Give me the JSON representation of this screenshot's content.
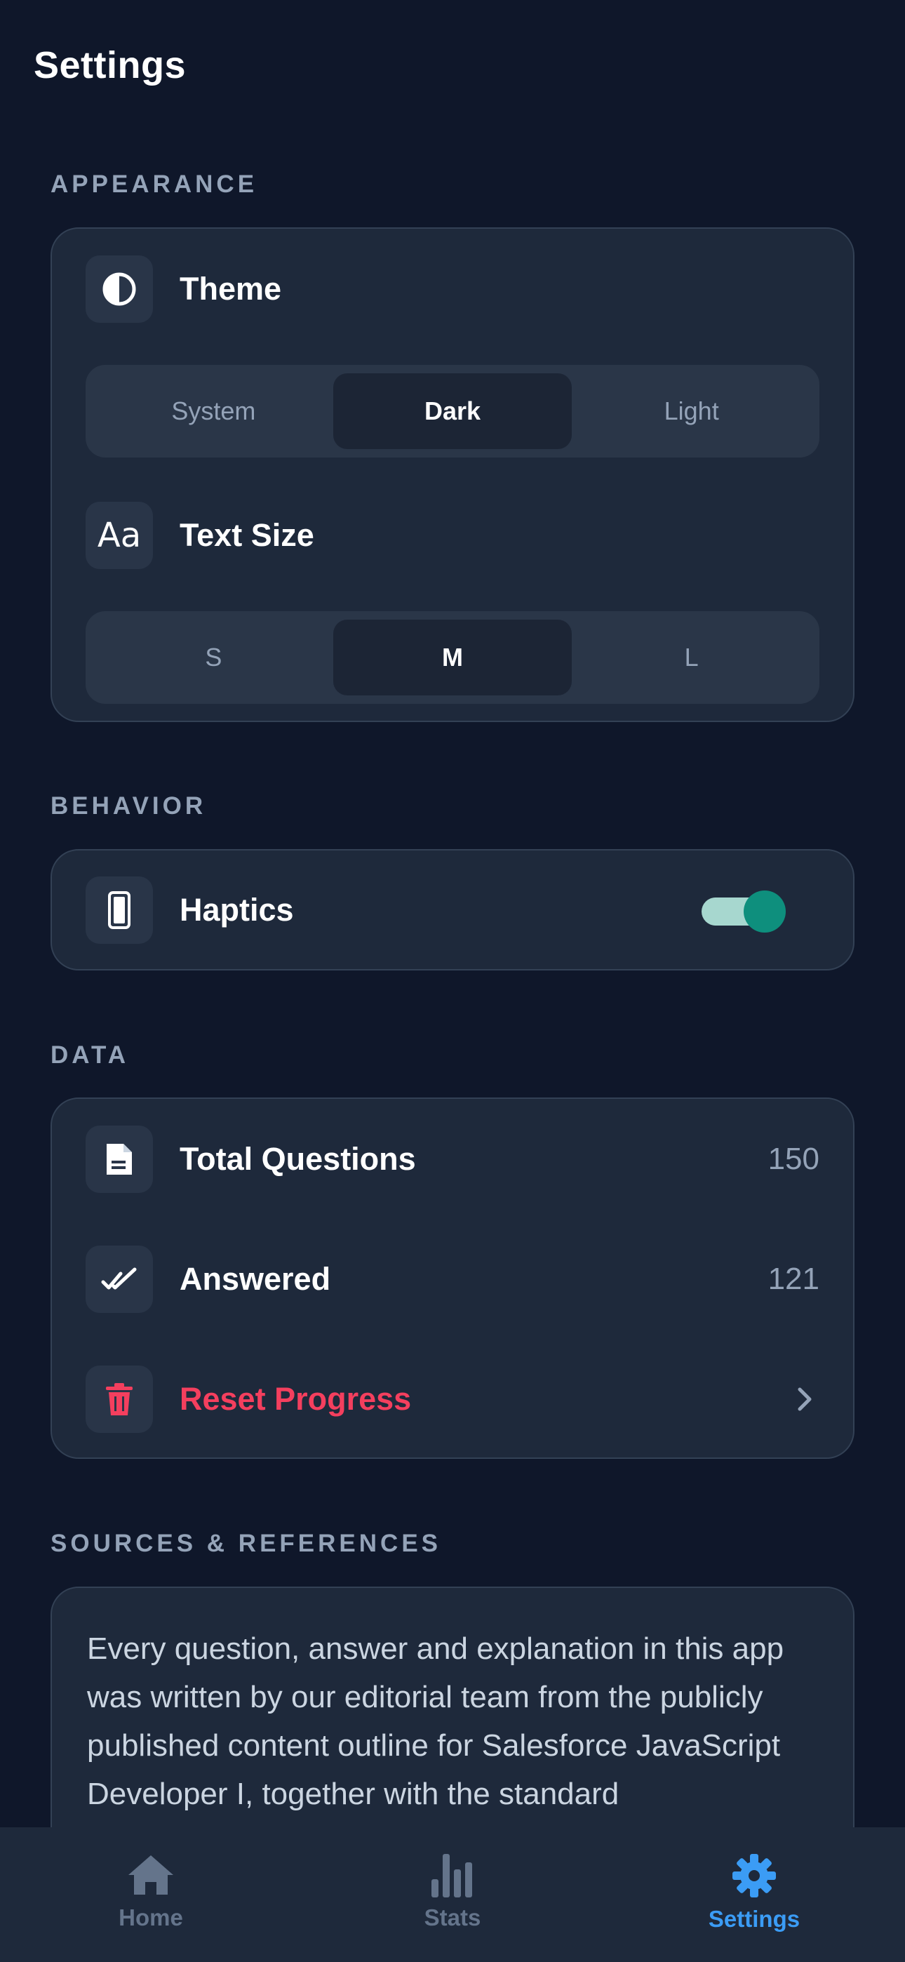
{
  "page": {
    "title": "Settings"
  },
  "sections": {
    "appearance": "APPEARANCE",
    "behavior": "BEHAVIOR",
    "data": "DATA",
    "sources": "SOURCES & REFERENCES"
  },
  "theme": {
    "label": "Theme",
    "icon": "half-circle-icon",
    "options": [
      "System",
      "Dark",
      "Light"
    ],
    "selected": "Dark"
  },
  "text_size": {
    "label": "Text Size",
    "icon": "text-aa-icon",
    "options": [
      "S",
      "M",
      "L"
    ],
    "selected": "M"
  },
  "haptics": {
    "label": "Haptics",
    "icon": "phone-icon",
    "enabled": true
  },
  "data_rows": {
    "total_label": "Total Questions",
    "total_value": "150",
    "answered_label": "Answered",
    "answered_value": "121",
    "reset_label": "Reset Progress"
  },
  "sources_text": "Every question, answer and explanation in this app was written by our editorial team from the publicly published content outline for Salesforce JavaScript Developer I, together with the standard",
  "tabs": [
    {
      "label": "Home",
      "icon": "home-icon",
      "active": false
    },
    {
      "label": "Stats",
      "icon": "bar-chart-icon",
      "active": false
    },
    {
      "label": "Settings",
      "icon": "gear-icon",
      "active": true
    }
  ],
  "colors": {
    "background": "#0f172a",
    "card": "#1e293b",
    "accent": "#3b9cf5",
    "toggle_on": "#0e8f7d",
    "danger": "#f43f5e"
  }
}
